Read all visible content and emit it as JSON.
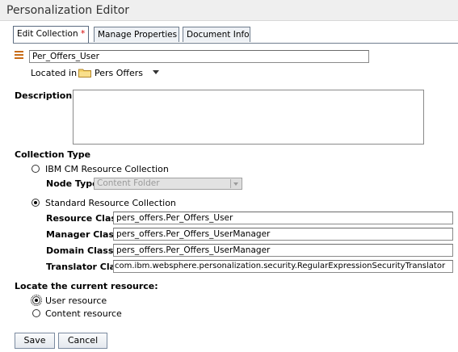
{
  "window": {
    "title": "Personalization Editor"
  },
  "tabs": [
    {
      "label": "Edit Collection",
      "modified_marker": "*"
    },
    {
      "label": "Manage Properties"
    },
    {
      "label": "Document Info"
    }
  ],
  "collection": {
    "name_value": "Per_Offers_User",
    "located_in_label": "Located in",
    "folder_name": "Pers Offers"
  },
  "description": {
    "label": "Description",
    "value": ""
  },
  "collection_type": {
    "heading": "Collection Type",
    "ibm_cm_label": "IBM CM Resource Collection",
    "node_type_label": "Node Type",
    "node_type_value": "Content Folder",
    "standard_label": "Standard Resource Collection",
    "selected": "Standard Resource Collection"
  },
  "classes": {
    "resource_label": "Resource Class",
    "resource_value": "pers_offers.Per_Offers_User",
    "manager_label": "Manager Class",
    "manager_value": "pers_offers.Per_Offers_UserManager",
    "domain_label": "Domain Class",
    "domain_value": "pers_offers.Per_Offers_UserManager",
    "translator_label": "Translator Class",
    "translator_value": "com.ibm.websphere.personalization.security.RegularExpressionSecurityTranslator"
  },
  "locate": {
    "heading": "Locate the current resource:",
    "user_label": "User resource",
    "content_label": "Content resource",
    "selected": "User resource"
  },
  "buttons": {
    "save": "Save",
    "cancel": "Cancel"
  },
  "icons": {
    "collection": "collection-icon",
    "folder": "folder-icon",
    "dropdown": "chevron-down-icon"
  }
}
